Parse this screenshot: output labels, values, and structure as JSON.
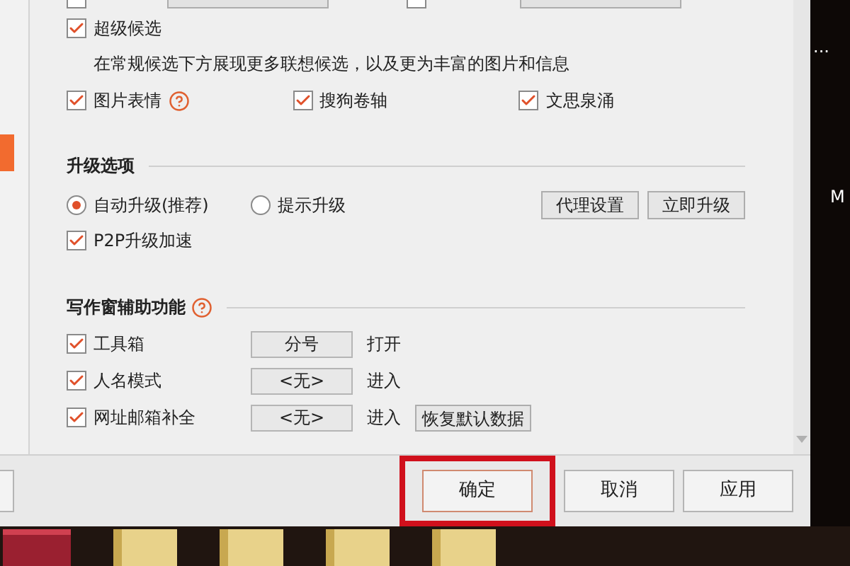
{
  "top_row": {
    "checkboxes": [
      {
        "checked": false
      },
      {
        "checked": false
      }
    ]
  },
  "candidate": {
    "super": {
      "label": "超级候选",
      "checked": true
    },
    "description": "在常规候选下方展现更多联想候选，以及更为丰富的图片和信息",
    "options": [
      {
        "label": "图片表情",
        "checked": true,
        "help": true
      },
      {
        "label": "搜狗卷轴",
        "checked": true,
        "help": false
      },
      {
        "label": "文思泉涌",
        "checked": true,
        "help": false
      }
    ]
  },
  "upgrade": {
    "title": "升级选项",
    "modes": [
      {
        "label": "自动升级(推荐)",
        "selected": true
      },
      {
        "label": "提示升级",
        "selected": false
      }
    ],
    "buttons": [
      "代理设置",
      "立即升级"
    ],
    "p2p": {
      "label": "P2P升级加速",
      "checked": true
    }
  },
  "writing": {
    "title": "写作窗辅助功能",
    "help": true,
    "rows": [
      {
        "label": "工具箱",
        "checked": true,
        "key": "分号",
        "action": "打开"
      },
      {
        "label": "人名模式",
        "checked": true,
        "key": "<无>",
        "action": "进入"
      },
      {
        "label": "网址邮箱补全",
        "checked": true,
        "key": "<无>",
        "action": "进入",
        "extra_button": "恢复默认数据"
      }
    ]
  },
  "footer": {
    "buttons": [
      {
        "label": "确定",
        "highlighted": true
      },
      {
        "label": "取消",
        "highlighted": false
      },
      {
        "label": "应用",
        "highlighted": false
      }
    ]
  },
  "desktop": {
    "texts": [
      "...",
      "M"
    ]
  }
}
